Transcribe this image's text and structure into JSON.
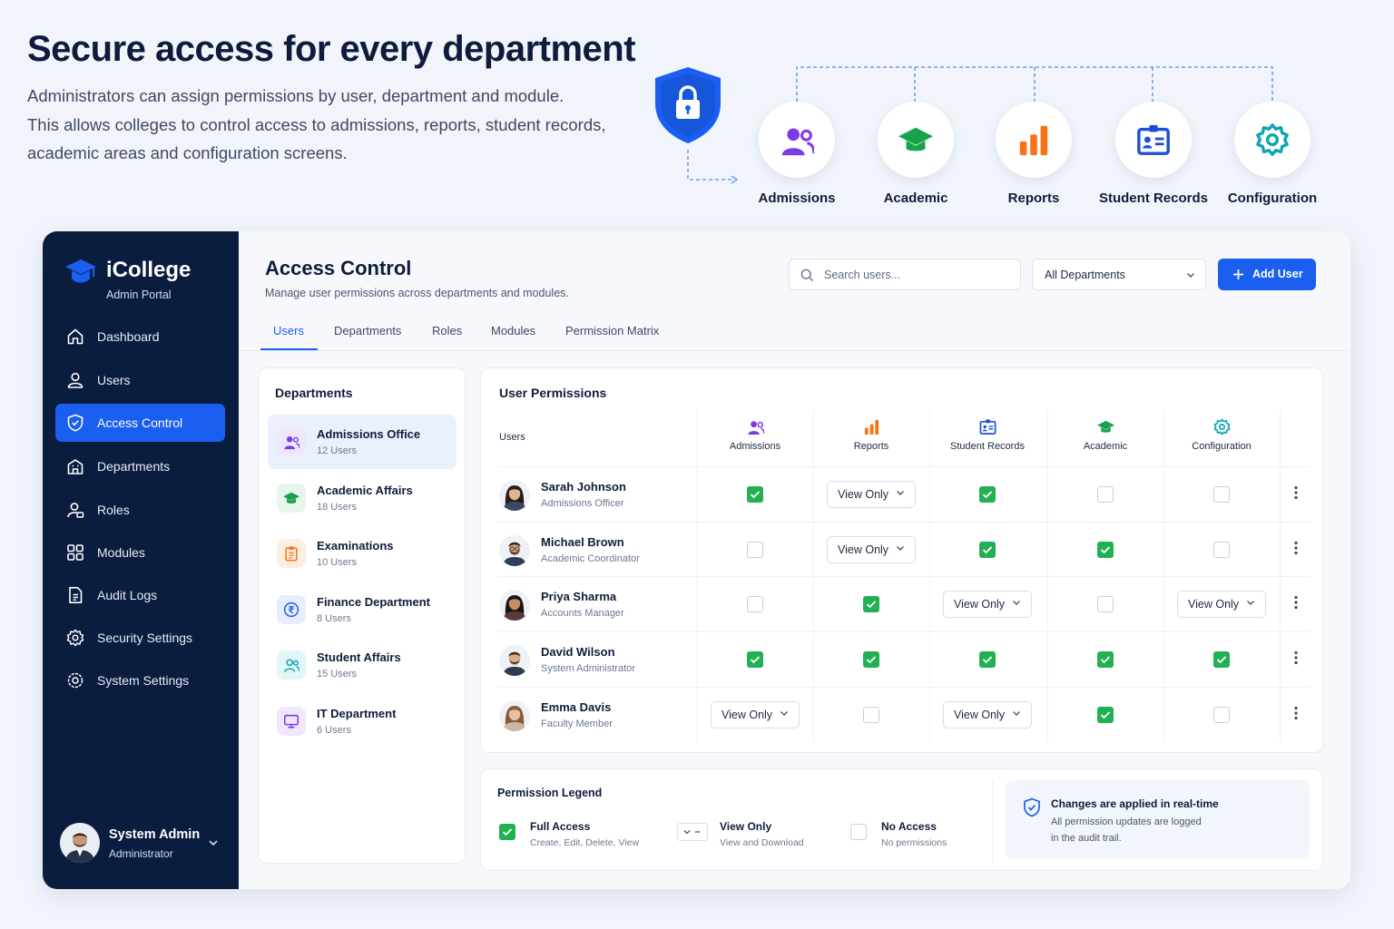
{
  "hero": {
    "title": "Secure access for every department",
    "description_lines": [
      "Administrators can assign permissions by user, department and module.",
      "This allows colleges to control access to admissions, reports, student records,",
      "academic areas and configuration screens."
    ],
    "modules": [
      {
        "label": "Admissions",
        "icon": "users-icon",
        "color": "#7c3aed"
      },
      {
        "label": "Academic",
        "icon": "graduation-cap-icon",
        "color": "#16a34a"
      },
      {
        "label": "Reports",
        "icon": "bar-chart-icon",
        "color": "#f97316"
      },
      {
        "label": "Student Records",
        "icon": "id-card-icon",
        "color": "#1d4ed8"
      },
      {
        "label": "Configuration",
        "icon": "gear-icon",
        "color": "#0ea5b7"
      }
    ]
  },
  "sidebar": {
    "brand": "iCollege",
    "brand_sub": "Admin Portal",
    "items": [
      {
        "label": "Dashboard",
        "icon": "home-icon"
      },
      {
        "label": "Users",
        "icon": "user-icon"
      },
      {
        "label": "Access Control",
        "icon": "shield-icon",
        "active": true
      },
      {
        "label": "Departments",
        "icon": "building-icon"
      },
      {
        "label": "Roles",
        "icon": "roles-icon"
      },
      {
        "label": "Modules",
        "icon": "grid-icon"
      },
      {
        "label": "Audit Logs",
        "icon": "document-icon"
      },
      {
        "label": "Security Settings",
        "icon": "security-gear-icon"
      },
      {
        "label": "System Settings",
        "icon": "settings-icon"
      }
    ],
    "profile": {
      "name": "System Admin",
      "role": "Administrator"
    }
  },
  "header": {
    "title": "Access Control",
    "subtitle": "Manage user permissions across departments and modules.",
    "search_placeholder": "Search users...",
    "department_filter": "All Departments",
    "add_user_label": "Add User"
  },
  "tabs": [
    {
      "label": "Users",
      "active": true
    },
    {
      "label": "Departments"
    },
    {
      "label": "Roles"
    },
    {
      "label": "Modules"
    },
    {
      "label": "Permission Matrix"
    }
  ],
  "departments": {
    "title": "Departments",
    "items": [
      {
        "name": "Admissions Office",
        "count": "12 Users",
        "icon": "users-icon",
        "color": "#7c3aed",
        "bg": "#efe8fd",
        "active": true
      },
      {
        "name": "Academic Affairs",
        "count": "18 Users",
        "icon": "graduation-cap-icon",
        "color": "#16a34a",
        "bg": "#e6f6ec"
      },
      {
        "name": "Examinations",
        "count": "10 Users",
        "icon": "clipboard-icon",
        "color": "#f97316",
        "bg": "#fdeee2"
      },
      {
        "name": "Finance Department",
        "count": "8 Users",
        "icon": "rupee-icon",
        "color": "#2563eb",
        "bg": "#e6eefc"
      },
      {
        "name": "Student Affairs",
        "count": "15 Users",
        "icon": "student-users-icon",
        "color": "#0ea5b7",
        "bg": "#e2f5f7"
      },
      {
        "name": "IT Department",
        "count": "6 Users",
        "icon": "monitor-icon",
        "color": "#7c3aed",
        "bg": "#efe8fd"
      }
    ]
  },
  "permissions": {
    "title": "User Permissions",
    "users_header": "Users",
    "columns": [
      {
        "label": "Admissions",
        "icon": "users-icon",
        "color": "#7c3aed"
      },
      {
        "label": "Reports",
        "icon": "bar-chart-icon",
        "color": "#f97316"
      },
      {
        "label": "Student Records",
        "icon": "id-card-icon",
        "color": "#1d4ed8"
      },
      {
        "label": "Academic",
        "icon": "graduation-cap-icon",
        "color": "#16a34a"
      },
      {
        "label": "Configuration",
        "icon": "gear-icon",
        "color": "#0ea5b7"
      }
    ],
    "rows": [
      {
        "name": "Sarah Johnson",
        "role": "Admissions Officer",
        "perms": [
          "full",
          "View Only",
          "full",
          "none",
          "none"
        ]
      },
      {
        "name": "Michael Brown",
        "role": "Academic Coordinator",
        "perms": [
          "none",
          "View Only",
          "full",
          "full",
          "none"
        ]
      },
      {
        "name": "Priya Sharma",
        "role": "Accounts Manager",
        "perms": [
          "none",
          "full",
          "View Only",
          "none",
          "View Only"
        ]
      },
      {
        "name": "David Wilson",
        "role": "System Administrator",
        "perms": [
          "full",
          "full",
          "full",
          "full",
          "full"
        ]
      },
      {
        "name": "Emma Davis",
        "role": "Faculty Member",
        "perms": [
          "View Only",
          "none",
          "View Only",
          "full",
          "none"
        ]
      }
    ]
  },
  "legend": {
    "title": "Permission Legend",
    "full_title": "Full Access",
    "full_desc": "Create, Edit, Delete, View",
    "view_title": "View Only",
    "view_desc": "View and Download",
    "none_title": "No Access",
    "none_desc": "No permissions",
    "note_title": "Changes are applied in real-time",
    "note_line1": "All permission updates are logged",
    "note_line2": "in the audit trail."
  },
  "colors": {
    "accent": "#1a5ff0",
    "sidebar": "#0b1d3f",
    "full_access": "#22b152"
  }
}
